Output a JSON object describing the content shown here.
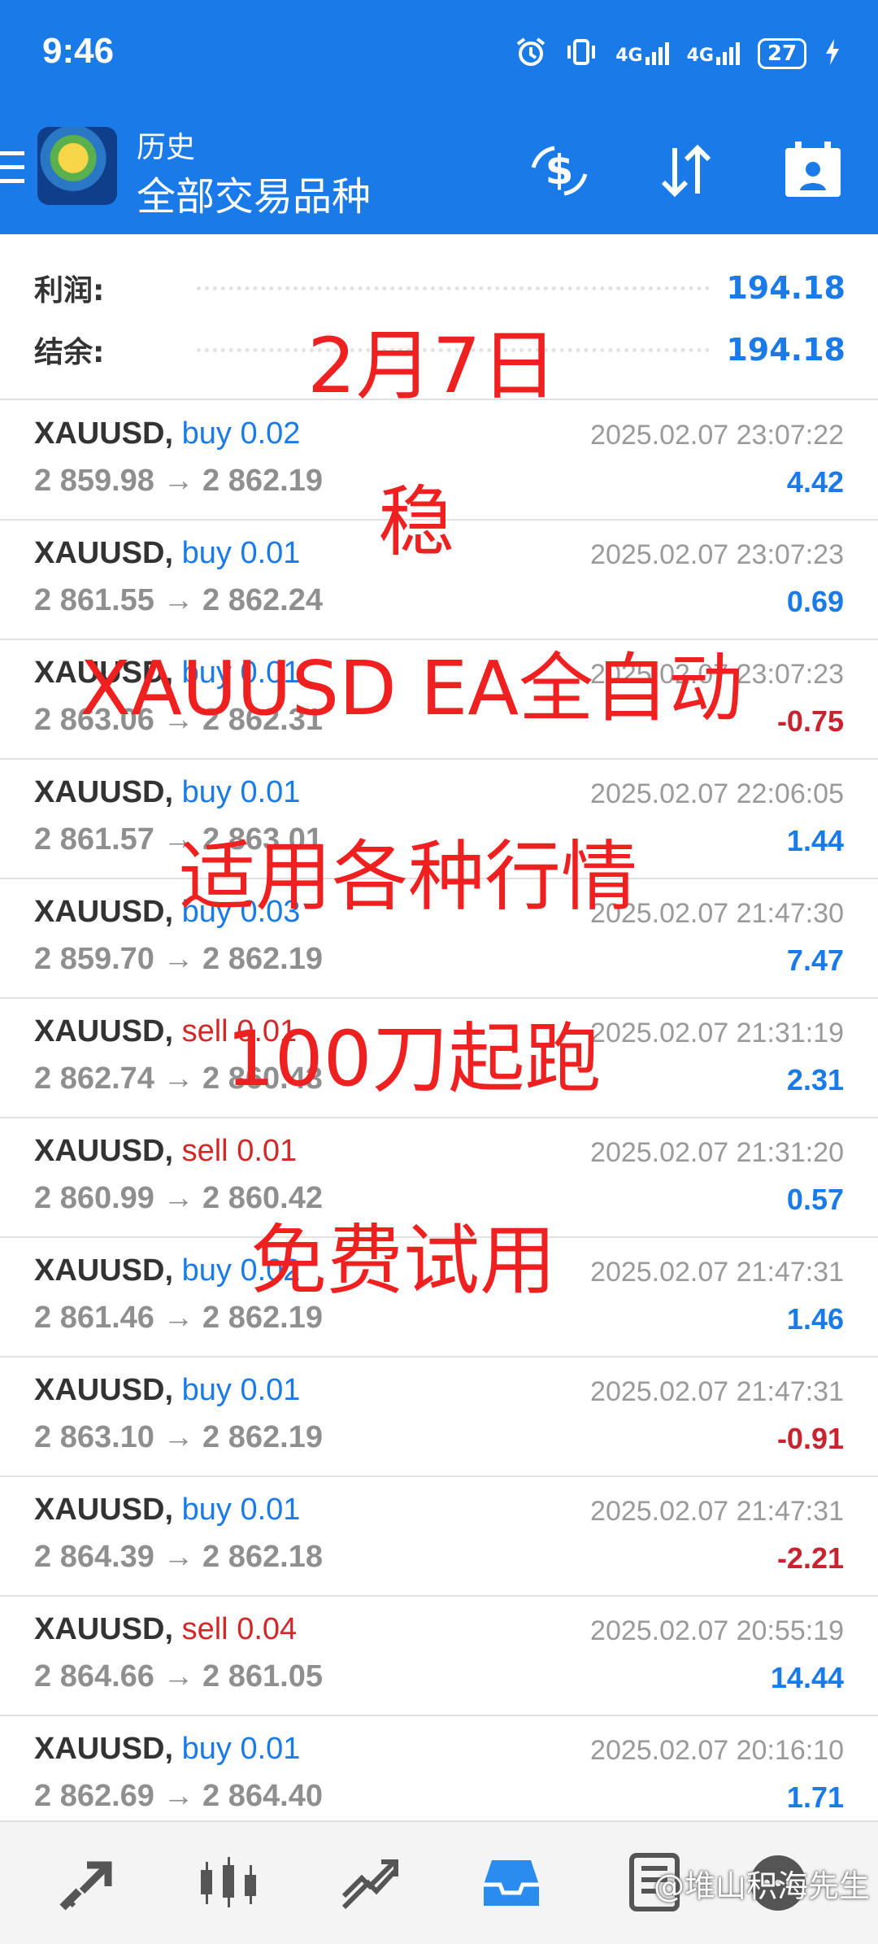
{
  "status_bar": {
    "time": "9:46",
    "network1": "4G",
    "network2": "4G",
    "battery": "27"
  },
  "appbar": {
    "title_small": "历史",
    "title_big": "全部交易品种"
  },
  "summary": {
    "profit_label": "利润:",
    "profit_value": "194.18",
    "balance_label": "结余:",
    "balance_value": "194.18"
  },
  "deals": [
    {
      "symbol": "XAUUSD",
      "side": "buy",
      "volume": "0.02",
      "open": "2 859.98",
      "close": "2 862.19",
      "datetime": "2025.02.07 23:07:22",
      "profit": "4.42"
    },
    {
      "symbol": "XAUUSD",
      "side": "buy",
      "volume": "0.01",
      "open": "2 861.55",
      "close": "2 862.24",
      "datetime": "2025.02.07 23:07:23",
      "profit": "0.69"
    },
    {
      "symbol": "XAUUSD",
      "side": "buy",
      "volume": "0.01",
      "open": "2 863.06",
      "close": "2 862.31",
      "datetime": "2025.02.07 23:07:23",
      "profit": "-0.75"
    },
    {
      "symbol": "XAUUSD",
      "side": "buy",
      "volume": "0.01",
      "open": "2 861.57",
      "close": "2 863.01",
      "datetime": "2025.02.07 22:06:05",
      "profit": "1.44"
    },
    {
      "symbol": "XAUUSD",
      "side": "buy",
      "volume": "0.03",
      "open": "2 859.70",
      "close": "2 862.19",
      "datetime": "2025.02.07 21:47:30",
      "profit": "7.47"
    },
    {
      "symbol": "XAUUSD",
      "side": "sell",
      "volume": "0.01",
      "open": "2 862.74",
      "close": "2 860.43",
      "datetime": "2025.02.07 21:31:19",
      "profit": "2.31"
    },
    {
      "symbol": "XAUUSD",
      "side": "sell",
      "volume": "0.01",
      "open": "2 860.99",
      "close": "2 860.42",
      "datetime": "2025.02.07 21:31:20",
      "profit": "0.57"
    },
    {
      "symbol": "XAUUSD",
      "side": "buy",
      "volume": "0.02",
      "open": "2 861.46",
      "close": "2 862.19",
      "datetime": "2025.02.07 21:47:31",
      "profit": "1.46"
    },
    {
      "symbol": "XAUUSD",
      "side": "buy",
      "volume": "0.01",
      "open": "2 863.10",
      "close": "2 862.19",
      "datetime": "2025.02.07 21:47:31",
      "profit": "-0.91"
    },
    {
      "symbol": "XAUUSD",
      "side": "buy",
      "volume": "0.01",
      "open": "2 864.39",
      "close": "2 862.18",
      "datetime": "2025.02.07 21:47:31",
      "profit": "-2.21"
    },
    {
      "symbol": "XAUUSD",
      "side": "sell",
      "volume": "0.04",
      "open": "2 864.66",
      "close": "2 861.05",
      "datetime": "2025.02.07 20:55:19",
      "profit": "14.44"
    },
    {
      "symbol": "XAUUSD",
      "side": "buy",
      "volume": "0.01",
      "open": "2 862.69",
      "close": "2 864.40",
      "datetime": "2025.02.07 20:16:10",
      "profit": "1.71"
    }
  ],
  "overlay": {
    "line1": "2月7日",
    "line2": "稳",
    "line3": "XAUUSD EA全自动",
    "line4": "适用各种行情",
    "line5": "100刀起跑",
    "line6": "免费试用"
  },
  "bottom_nav": {
    "items": [
      "quotes-icon",
      "chart-icon",
      "trade-icon",
      "history-icon",
      "news-icon",
      "chat-icon"
    ],
    "watermark": "@堆山积海先生"
  },
  "colors": {
    "accent": "#1a7be8",
    "loss": "#c8232f",
    "overlay": "#ee2020"
  }
}
